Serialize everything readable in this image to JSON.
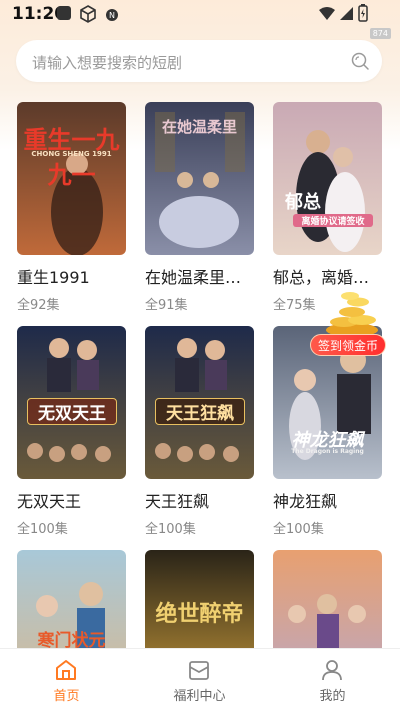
{
  "status_bar": {
    "time": "11:20"
  },
  "version_tag": "874",
  "search": {
    "placeholder": "请输入想要搜索的短剧"
  },
  "floating_badge": {
    "label": "签到领金币"
  },
  "dramas": [
    {
      "title": "重生1991",
      "episodes": "全92集",
      "poster_text": "重生一九九一",
      "poster_sub": "CHONG SHENG 1991",
      "colors": [
        "#5b3a2a",
        "#c06a3a"
      ]
    },
    {
      "title": "在她温柔里…",
      "episodes": "全91集",
      "poster_text": "在她温柔里",
      "poster_sub": "",
      "colors": [
        "#3a3f58",
        "#8a8fa8"
      ]
    },
    {
      "title": "郁总，离婚…",
      "episodes": "全75集",
      "poster_text": "郁总",
      "poster_sub": "离婚协议请签收",
      "colors": [
        "#c9a9b4",
        "#e8d5c8"
      ]
    },
    {
      "title": "无双天王",
      "episodes": "全100集",
      "poster_text": "无双天王",
      "poster_sub": "",
      "colors": [
        "#1e2a4a",
        "#6a5a3a"
      ]
    },
    {
      "title": "天王狂飙",
      "episodes": "全100集",
      "poster_text": "天王狂飙",
      "poster_sub": "",
      "colors": [
        "#1e2a4a",
        "#6a5a3a"
      ]
    },
    {
      "title": "神龙狂飙",
      "episodes": "全100集",
      "poster_text": "神龙狂飙",
      "poster_sub": "The Dragon is Raging",
      "colors": [
        "#5a6478",
        "#b8c0cc"
      ]
    },
    {
      "title": "",
      "episodes": "",
      "poster_text": "寒门状元",
      "poster_sub": "",
      "colors": [
        "#a8c8d8",
        "#d8b890"
      ]
    },
    {
      "title": "",
      "episodes": "",
      "poster_text": "绝世醉帝",
      "poster_sub": "",
      "colors": [
        "#2a2418",
        "#c89a3a"
      ]
    },
    {
      "title": "",
      "episodes": "",
      "poster_text": "",
      "poster_sub": "",
      "colors": [
        "#e8a070",
        "#b8a8c8"
      ]
    }
  ],
  "bottom_nav": [
    {
      "label": "首页",
      "icon": "home-icon",
      "active": true
    },
    {
      "label": "福利中心",
      "icon": "gift-box-icon",
      "active": false
    },
    {
      "label": "我的",
      "icon": "user-icon",
      "active": false
    }
  ],
  "colors": {
    "accent": "#ff7a22",
    "badge": "#ff3a30"
  }
}
